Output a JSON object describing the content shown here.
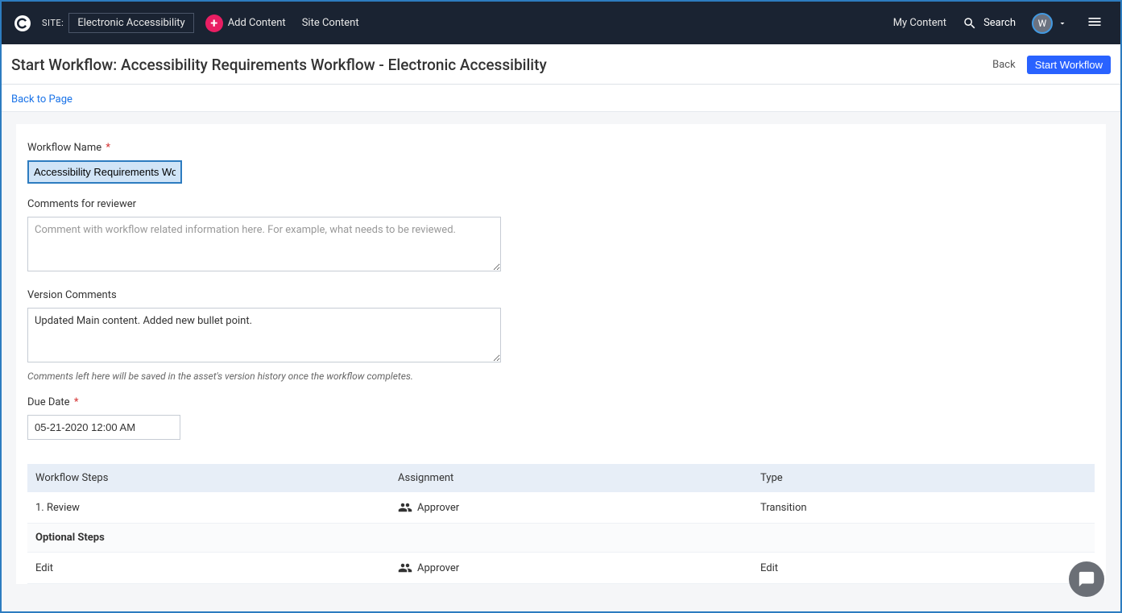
{
  "topbar": {
    "site_label": "SITE:",
    "site_name": "Electronic Accessibility",
    "add_content": "Add Content",
    "site_content": "Site Content",
    "my_content": "My Content",
    "search": "Search",
    "user_initial": "W"
  },
  "header": {
    "title": "Start Workflow: Accessibility Requirements Workflow - Electronic Accessibility",
    "back": "Back",
    "start": "Start Workflow"
  },
  "breadcrumb": {
    "back_to_page": "Back to Page"
  },
  "form": {
    "workflow_name_label": "Workflow Name",
    "workflow_name_value": "Accessibility Requirements Workflow",
    "comments_label": "Comments for reviewer",
    "comments_placeholder": "Comment with workflow related information here. For example, what needs to be reviewed.",
    "comments_value": "",
    "version_label": "Version Comments",
    "version_value": "Updated Main content. Added new bullet point.",
    "version_help": "Comments left here will be saved in the asset's version history once the workflow completes.",
    "due_date_label": "Due Date",
    "due_date_value": "05-21-2020 12:00 AM"
  },
  "table": {
    "col_step": "Workflow Steps",
    "col_assign": "Assignment",
    "col_type": "Type",
    "rows": [
      {
        "step": "1. Review",
        "assign": "Approver",
        "type": "Transition"
      }
    ],
    "optional_label": "Optional Steps",
    "optional_rows": [
      {
        "step": "Edit",
        "assign": "Approver",
        "type": "Edit"
      }
    ]
  }
}
